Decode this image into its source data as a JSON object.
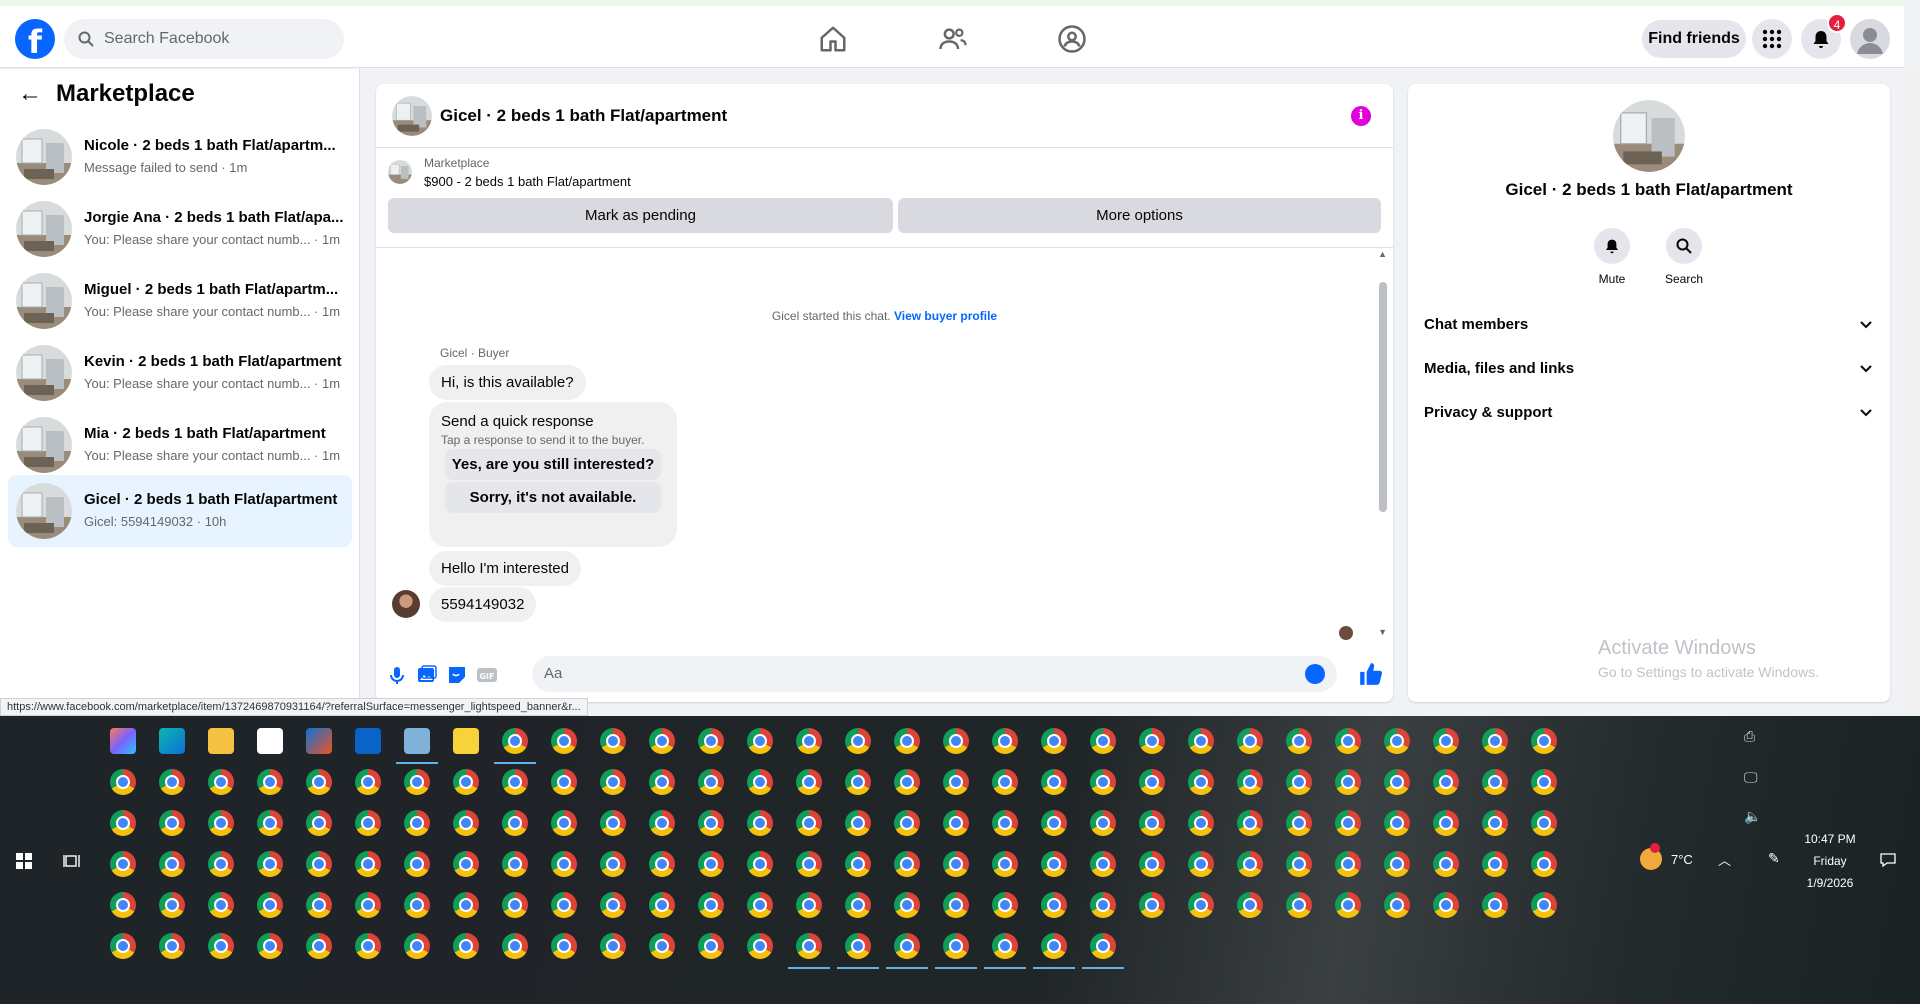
{
  "topbar": {
    "search_placeholder": "Search Facebook",
    "find_friends": "Find friends",
    "notification_count": "4"
  },
  "sidebar": {
    "title": "Marketplace",
    "conversations": [
      {
        "name": "Nicole · 2 beds 1 bath Flat/apartm...",
        "sub": "Message failed to send · 1m"
      },
      {
        "name": "Jorgie Ana · 2 beds 1 bath Flat/apa...",
        "sub": "You: Please share your contact numb... · 1m"
      },
      {
        "name": "Miguel · 2 beds 1 bath Flat/apartm...",
        "sub": "You: Please share your contact numb... · 1m"
      },
      {
        "name": "Kevin · 2 beds 1 bath Flat/apartment",
        "sub": "You: Please share your contact numb... · 1m"
      },
      {
        "name": "Mia · 2 beds 1 bath Flat/apartment",
        "sub": "You: Please share your contact numb... · 1m"
      },
      {
        "name": "Gicel · 2 beds 1 bath Flat/apartment",
        "sub": "Gicel: 5594149032 · 10h"
      }
    ]
  },
  "chat": {
    "title": "Gicel · 2 beds 1 bath Flat/apartment",
    "listing_source": "Marketplace",
    "listing_title": "$900 - 2 beds 1 bath Flat/apartment",
    "mark_pending": "Mark as pending",
    "more_options": "More options",
    "system_text": "Gicel started this chat.",
    "view_buyer": "View buyer profile",
    "sender_label": "Gicel · Buyer",
    "msg1": "Hi, is this available?",
    "quick_title": "Send a quick response",
    "quick_sub": "Tap a response to send it to the buyer.",
    "quick_1": "Yes, are you still interested?",
    "quick_2": "Sorry, it's not available.",
    "msg2": "Hello I'm interested",
    "msg3": "5594149032",
    "composer_placeholder": "Aa"
  },
  "details": {
    "title": "Gicel · 2 beds 1 bath Flat/apartment",
    "mute": "Mute",
    "search": "Search",
    "chat_members": "Chat members",
    "media": "Media, files and links",
    "privacy": "Privacy & support"
  },
  "watermark": {
    "line1": "Activate Windows",
    "line2": "Go to Settings to activate Windows."
  },
  "status_url": "https://www.facebook.com/marketplace/item/1372469870931164/?referralSurface=messenger_lightspeed_banner&r...",
  "taskbar": {
    "weather_temp": "7°C",
    "time": "10:47 PM",
    "day": "Friday",
    "date": "1/9/2026"
  }
}
